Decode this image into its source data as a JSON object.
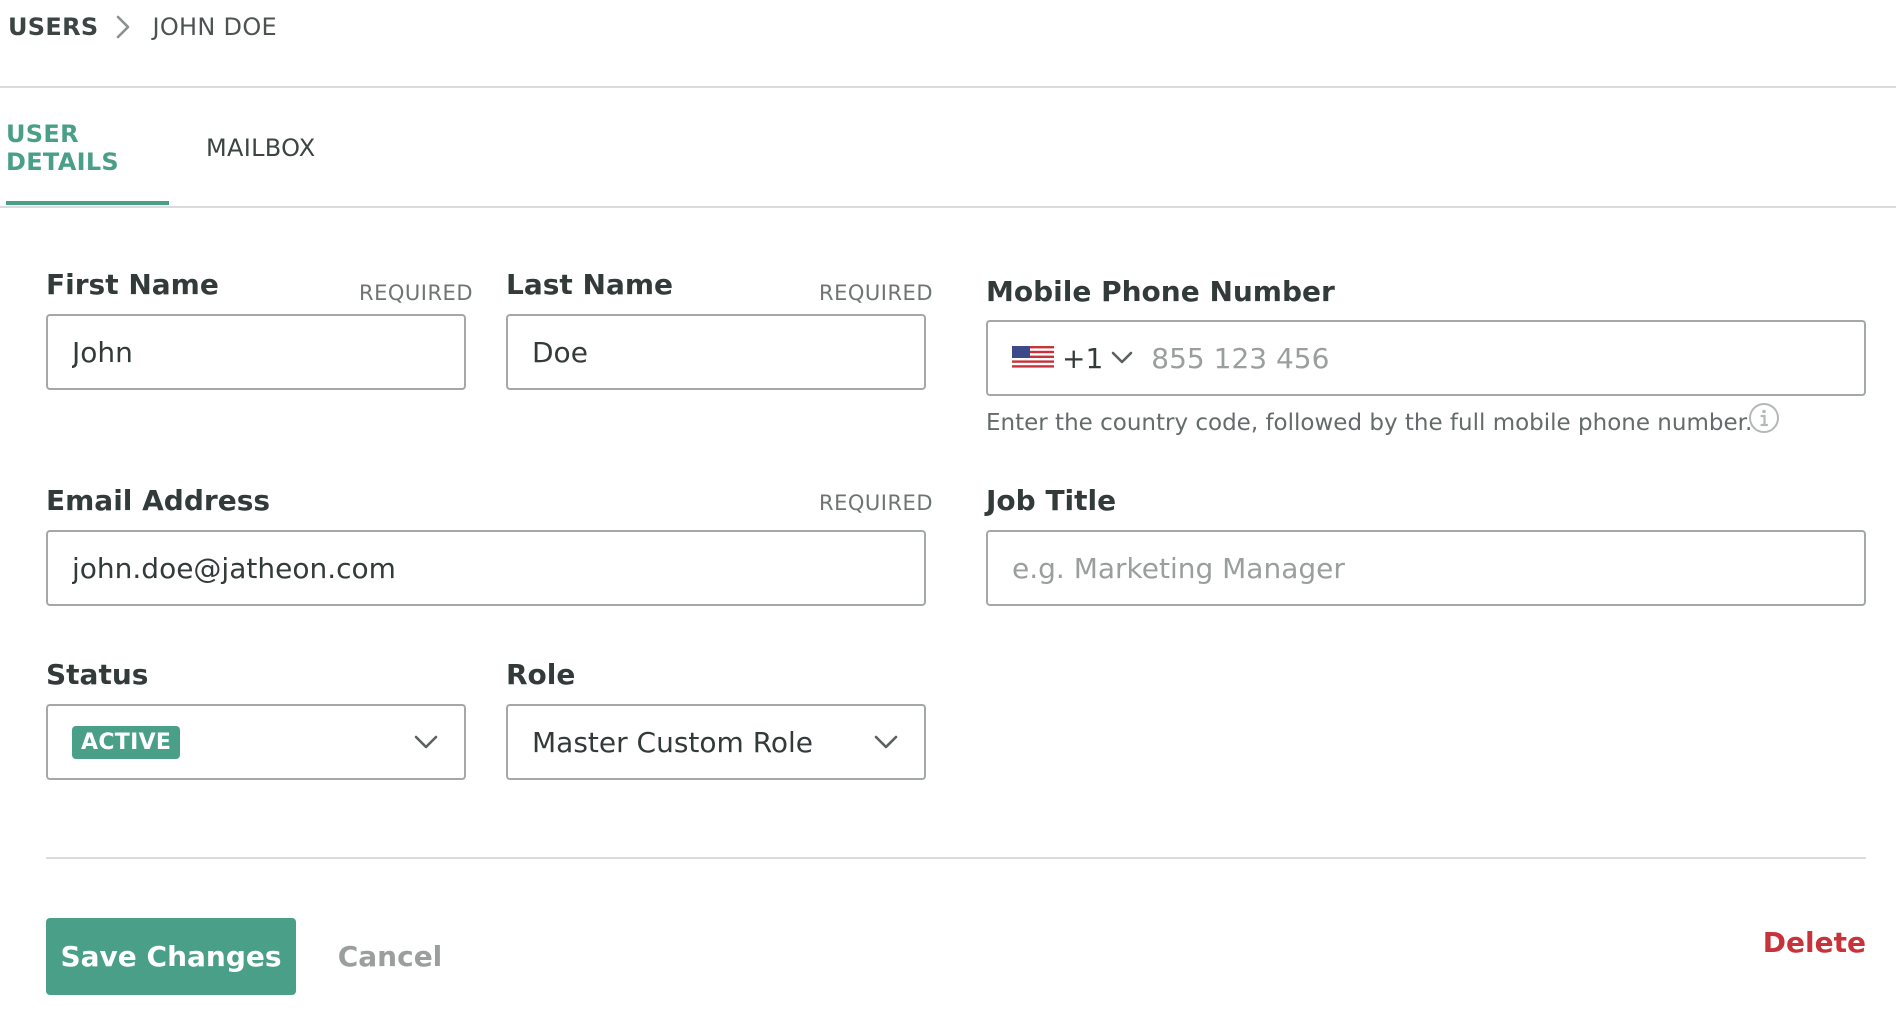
{
  "breadcrumb": {
    "root": "USERS",
    "current": "JOHN DOE"
  },
  "tabs": [
    {
      "label": "USER DETAILS",
      "active": true
    },
    {
      "label": "MAILBOX",
      "active": false
    }
  ],
  "form": {
    "first_name": {
      "label": "First Name",
      "required": "REQUIRED",
      "value": "John"
    },
    "last_name": {
      "label": "Last Name",
      "required": "REQUIRED",
      "value": "Doe"
    },
    "mobile": {
      "label": "Mobile Phone Number",
      "country_flag": "us-flag-icon",
      "country_code": "+1",
      "placeholder": "855 123 456",
      "helper": "Enter the country code, followed by the full mobile phone number."
    },
    "email": {
      "label": "Email Address",
      "required": "REQUIRED",
      "value": "john.doe@jatheon.com"
    },
    "job_title": {
      "label": "Job Title",
      "placeholder": "e.g. Marketing Manager"
    },
    "status": {
      "label": "Status",
      "value": "ACTIVE"
    },
    "role": {
      "label": "Role",
      "value": "Master Custom Role"
    }
  },
  "actions": {
    "save": "Save Changes",
    "cancel": "Cancel",
    "delete": "Delete"
  },
  "colors": {
    "accent": "#4a9f88",
    "danger": "#c8323a",
    "text": "#333b3a",
    "border": "#a4a8a7"
  }
}
